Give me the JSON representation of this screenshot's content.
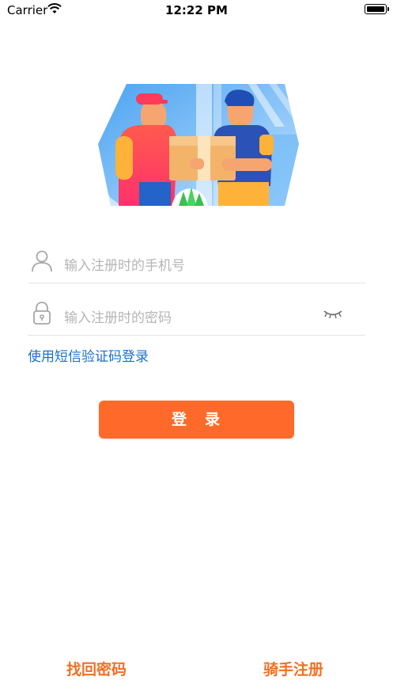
{
  "status_bar": {
    "carrier": "Carrier",
    "time": "12:22 PM"
  },
  "form": {
    "phone_placeholder": "输入注册时的手机号",
    "password_placeholder": "输入注册时的密码",
    "sms_login_link": "使用短信验证码登录"
  },
  "login_button": "登　录",
  "footer": {
    "forgot_password": "找回密码",
    "rider_register": "骑手注册"
  },
  "colors": {
    "accent": "#ff6a2a",
    "link": "#1a6fcf",
    "footer_link": "#f07023"
  }
}
